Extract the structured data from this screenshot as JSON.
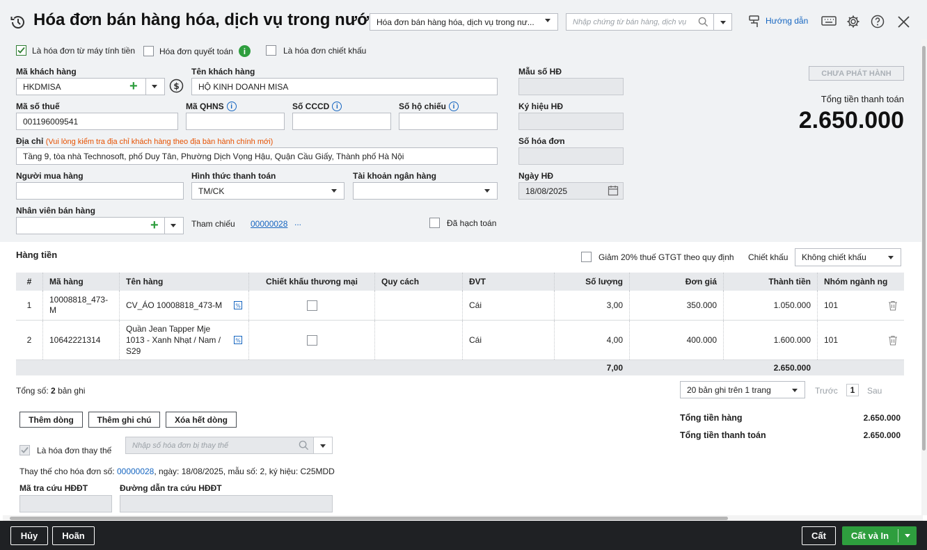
{
  "header": {
    "title": "Hóa đơn bán hàng hóa, dịch vụ trong nước",
    "type_select": "Hóa đơn bán hàng hóa, dịch vụ trong nư...",
    "search_placeholder": "Nhập chứng từ bán hàng, dịch vụ",
    "guide": "Hướng dẫn"
  },
  "options": {
    "cash_register": "Là hóa đơn từ máy tính tiền",
    "settlement": "Hóa đơn quyết toán",
    "discount_invoice": "Là hóa đơn chiết khấu"
  },
  "customer": {
    "code_label": "Mã khách hàng",
    "code": "HKDMISA",
    "name_label": "Tên khách hàng",
    "name": "HỘ KINH DOANH MISA",
    "tax_label": "Mã số thuế",
    "tax": "001196009541",
    "qhns_label": "Mã QHNS",
    "cccd_label": "Số CCCD",
    "passport_label": "Số hộ chiếu",
    "address_label": "Địa chỉ",
    "address_note": "(Vui lòng kiểm tra địa chỉ khách hàng theo địa bàn hành chính mới)",
    "address": "Tầng 9, tòa nhà Technosoft, phố Duy Tân, Phường Dịch Vọng Hậu, Quận Cầu Giấy, Thành phố Hà Nội",
    "buyer_label": "Người mua hàng",
    "payment_label": "Hình thức thanh toán",
    "payment": "TM/CK",
    "bank_label": "Tài khoản ngân hàng",
    "seller_label": "Nhân viên bán hàng",
    "ref_label": "Tham chiếu",
    "ref": "00000028",
    "ref_more": "...",
    "posted": "Đã hạch toán"
  },
  "invoice": {
    "form_label": "Mẫu số HĐ",
    "symbol_label": "Ký hiệu HĐ",
    "number_label": "Số hóa đơn",
    "date_label": "Ngày HĐ",
    "date": "18/08/2025",
    "status": "CHƯA PHÁT HÀNH",
    "total_label": "Tổng tiền thanh toán",
    "total": "2.650.000"
  },
  "items": {
    "section": "Hàng tiền",
    "vat_reduce": "Giảm 20% thuế GTGT theo quy định",
    "discount_label": "Chiết khấu",
    "discount": "Không chiết khấu",
    "columns": [
      "#",
      "Mã hàng",
      "Tên hàng",
      "Chiết khấu thương mại",
      "Quy cách",
      "ĐVT",
      "Số lượng",
      "Đơn giá",
      "Thành tiền",
      "Nhóm ngành ng"
    ],
    "rows": [
      {
        "no": "1",
        "code": "10008818_473-M",
        "name": "CV_ÁO 10008818_473-M",
        "unit": "Cái",
        "qty": "3,00",
        "price": "350.000",
        "amount": "1.050.000",
        "group": "101"
      },
      {
        "no": "2",
        "code": "10642221314",
        "name": "Quần Jean Tapper Mje 1013 - Xanh Nhạt / Nam / S29",
        "unit": "Cái",
        "qty": "4,00",
        "price": "400.000",
        "amount": "1.600.000",
        "group": "101"
      }
    ],
    "sum_qty": "7,00",
    "sum_amount": "2.650.000"
  },
  "pager": {
    "total_prefix": "Tổng số:",
    "total_count": "2",
    "total_suffix": "bản ghi",
    "per_page": "20 bản ghi trên 1 trang",
    "prev": "Trước",
    "page": "1",
    "next": "Sau"
  },
  "actions": {
    "add_row": "Thêm dòng",
    "add_note": "Thêm ghi chú",
    "clear_rows": "Xóa hết dòng"
  },
  "totals": {
    "goods_label": "Tổng tiền hàng",
    "goods": "2.650.000",
    "pay_label": "Tổng tiền thanh toán",
    "pay": "2.650.000"
  },
  "replace": {
    "label": "Là hóa đơn thay thế",
    "placeholder": "Nhập số hóa đơn bị thay thế",
    "info_prefix": "Thay thế cho hóa đơn số:",
    "info_no": "00000028",
    "info_rest": ", ngày:  18/08/2025, mẫu số:  2, ký hiệu:  C25MDD",
    "lookup_label": "Mã tra cứu HĐĐT",
    "url_label": "Đường dẫn tra cứu HĐĐT"
  },
  "footer": {
    "cancel": "Hủy",
    "undo": "Hoãn",
    "save": "Cất",
    "save_print": "Cất và In"
  },
  "colors": {
    "accent": "#2e7d32",
    "link": "#1565c0",
    "footer": "#1f2124"
  }
}
